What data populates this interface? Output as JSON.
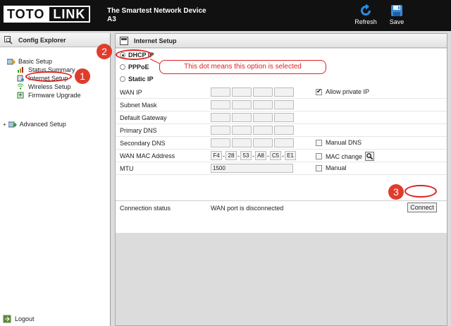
{
  "header": {
    "logo_left": "TOTO",
    "logo_right": "LINK",
    "tagline": "The Smartest Network Device",
    "model": "A3",
    "refresh_label": "Refresh",
    "save_label": "Save"
  },
  "left_panel": {
    "title": "Config Explorer",
    "basic_setup": "Basic Setup",
    "items": [
      "Status Summary",
      "Internet Setup",
      "Wireless Setup",
      "Firmware Upgrade"
    ],
    "advanced_setup": "Advanced Setup",
    "logout": "Logout"
  },
  "main": {
    "title": "Internet Setup",
    "modes": [
      {
        "label": "DHCP IP",
        "selected": true
      },
      {
        "label": "PPPoE",
        "selected": false
      },
      {
        "label": "Static IP",
        "selected": false
      }
    ],
    "fields": {
      "wan_ip": "WAN IP",
      "subnet_mask": "Subnet Mask",
      "default_gateway": "Default Gateway",
      "primary_dns": "Primary DNS",
      "secondary_dns": "Secondary DNS",
      "wan_mac": "WAN MAC Address",
      "mtu": "MTU"
    },
    "mac_octets": [
      "F4",
      "28",
      "53",
      "A8",
      "C5",
      "E1"
    ],
    "mac_separator": "-",
    "mtu_value": "1500",
    "options": {
      "allow_private_ip": "Allow private IP",
      "allow_private_ip_checked": true,
      "manual_dns": "Manual DNS",
      "manual_dns_checked": false,
      "mac_change": "MAC change",
      "mac_change_checked": false,
      "manual": "Manual",
      "manual_checked": false
    },
    "connection_status_label": "Connection status",
    "connection_status_value": "WAN port is disconnected",
    "connect_label": "Connect"
  },
  "annotations": {
    "badge_1": "1",
    "badge_2": "2",
    "badge_3": "3",
    "callout": "This dot means this option is selected"
  },
  "colors": {
    "header_bg": "#111111",
    "annotation_red": "#e03c2c",
    "panel_bg": "#dcdcdc"
  }
}
